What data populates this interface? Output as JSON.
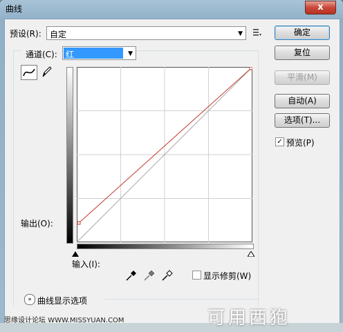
{
  "window": {
    "title": "曲线",
    "close": "x"
  },
  "preset": {
    "label": "预设(R):",
    "value": "自定"
  },
  "channel": {
    "label": "通道(C):",
    "value": "红"
  },
  "buttons": {
    "ok": "确定",
    "reset": "复位",
    "smooth": "平滑(M)",
    "auto": "自动(A)",
    "options": "选项(T)..."
  },
  "preview": {
    "label": "预览(P)",
    "checked": true
  },
  "output_label": "输出(O):",
  "input_label": "输入(I):",
  "show_clipping": {
    "label": "显示修剪(W)",
    "checked": false
  },
  "curve_display_options": "曲线显示选项",
  "watermark": {
    "left": "思缘设计论坛 WWW.MISSYUAN.COM",
    "right": "可用西狍"
  },
  "icons": {
    "close": "close-icon",
    "preset_menu": "preset-options-icon",
    "curve_tool": "curve-point-tool-icon",
    "pencil_tool": "pencil-tool-icon",
    "black_eyedropper": "black-point-eyedropper-icon",
    "gray_eyedropper": "gray-point-eyedropper-icon",
    "white_eyedropper": "white-point-eyedropper-icon",
    "expand": "expand-chevron-icon"
  },
  "colors": {
    "curve": "#c0392b",
    "accent": "#3399ff"
  }
}
